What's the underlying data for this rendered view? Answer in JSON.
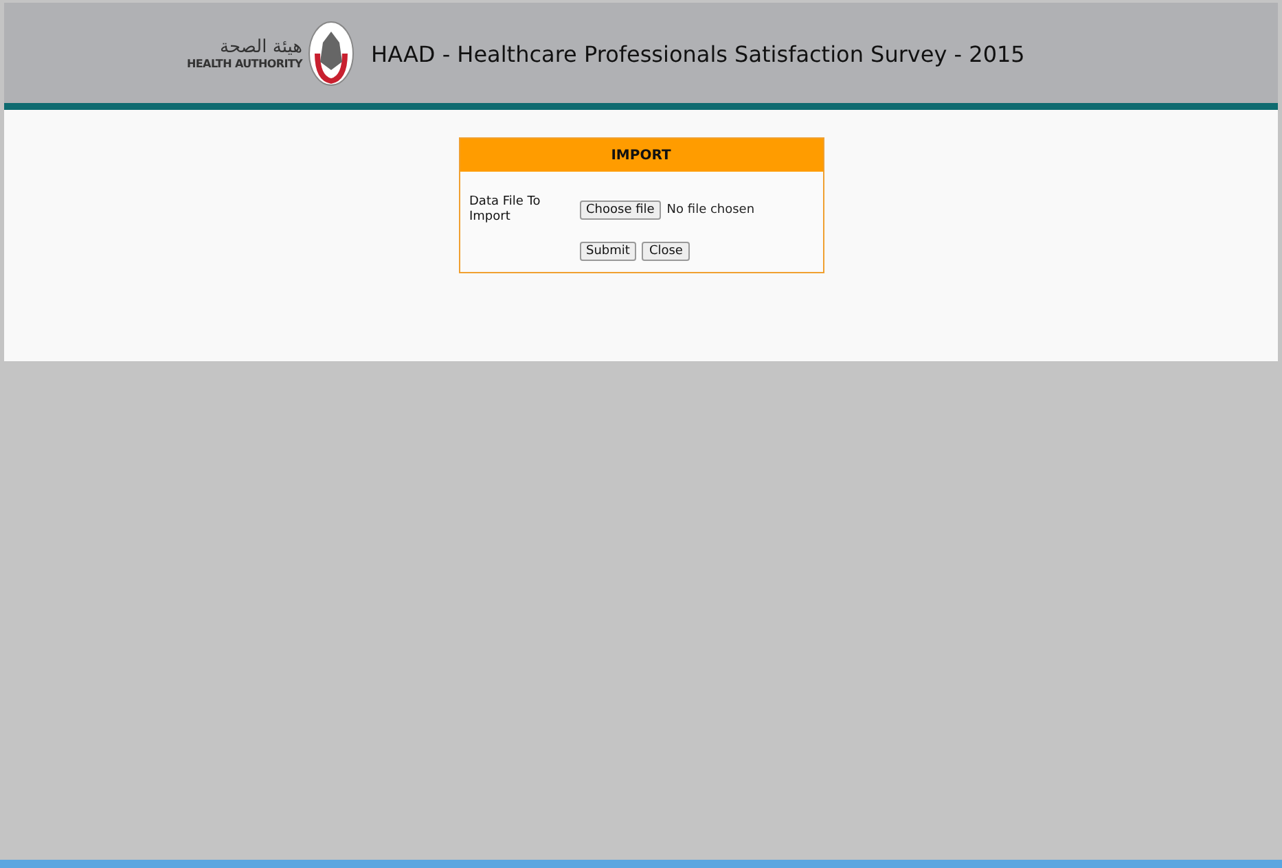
{
  "header": {
    "logo_arabic": "هيئة الصحة",
    "logo_english": "HEALTH AUTHORITY",
    "title": "HAAD - Healthcare Professionals Satisfaction Survey - 2015"
  },
  "import_panel": {
    "title": "IMPORT",
    "field_label": "Data File To Import",
    "file_button": "Choose file",
    "file_status": "No file chosen",
    "buttons": [
      "Submit",
      "Close"
    ]
  }
}
